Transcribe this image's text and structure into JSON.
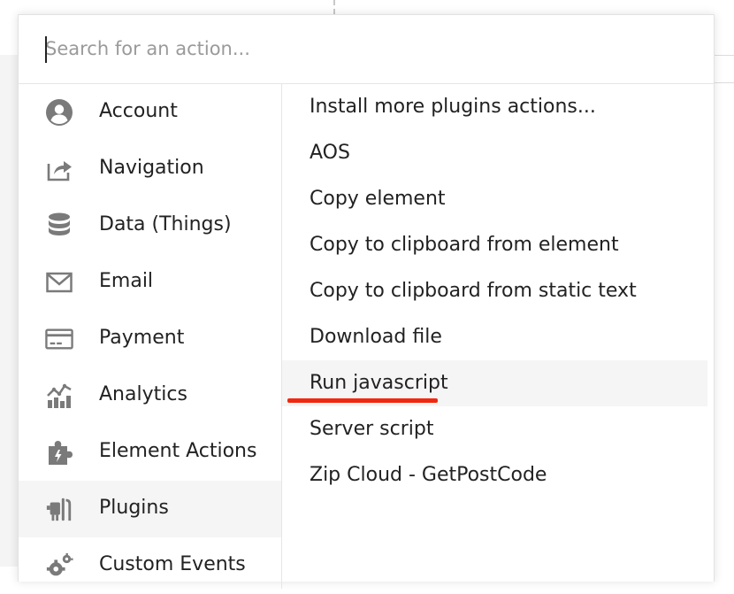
{
  "search": {
    "placeholder": "Search for an action..."
  },
  "categories": [
    {
      "label": "Account",
      "icon": "account-icon"
    },
    {
      "label": "Navigation",
      "icon": "navigation-icon"
    },
    {
      "label": "Data (Things)",
      "icon": "database-icon"
    },
    {
      "label": "Email",
      "icon": "email-icon"
    },
    {
      "label": "Payment",
      "icon": "credit-card-icon"
    },
    {
      "label": "Analytics",
      "icon": "analytics-icon"
    },
    {
      "label": "Element Actions",
      "icon": "puzzle-icon"
    },
    {
      "label": "Plugins",
      "icon": "plug-icon",
      "active": true
    },
    {
      "label": "Custom Events",
      "icon": "gears-icon"
    }
  ],
  "actions": [
    {
      "label": "Install more plugins actions..."
    },
    {
      "label": "AOS"
    },
    {
      "label": "Copy element"
    },
    {
      "label": "Copy to clipboard from element"
    },
    {
      "label": "Copy to clipboard from static text"
    },
    {
      "label": "Download file"
    },
    {
      "label": "Run javascript",
      "highlighted": true
    },
    {
      "label": "Server script"
    },
    {
      "label": "Zip Cloud - GetPostCode"
    }
  ],
  "colors": {
    "icon": "#7a7a7a",
    "highlight_underline": "#f0280f",
    "hover_background": "#f5f5f5"
  }
}
